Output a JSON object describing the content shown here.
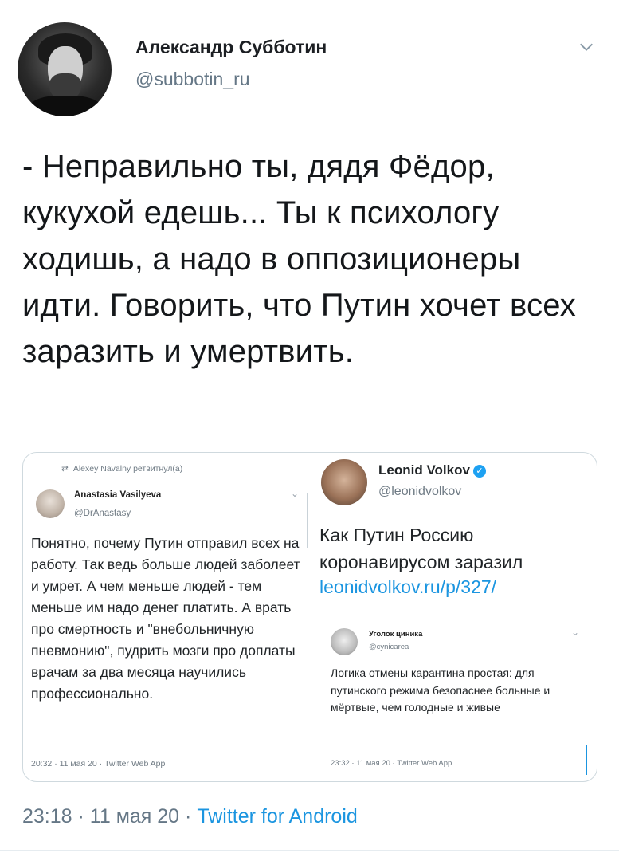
{
  "tweet": {
    "author_name": "Александр Субботин",
    "author_handle": "@subbotin_ru",
    "text": "- Неправильно ты, дядя Фёдор, кукухой едешь... Ты к психологу ходишь, а надо в оппозиционеры идти. Говорить, что Путин хочет всех заразить и умертвить.",
    "time": "23:18",
    "date": "11 мая 20",
    "client": "Twitter for Android",
    "separator": "·"
  },
  "embedded": {
    "left": {
      "retweeted_by": "Alexey Navalny ретвитнул(а)",
      "author_name": "Anastasia Vasilyeva",
      "author_handle": "@DrAnastasy",
      "text": "Понятно, почему Путин отправил всех на работу. Так ведь больше людей заболеет и умрет. А чем меньше людей - тем меньше им надо денег платить. А врать про смертность и \"внебольничную пневмонию\", пудрить мозги про доплаты врачам за два месяца научились профессионально.",
      "meta": "20:32 · 11 мая 20 · Twitter Web App"
    },
    "right": {
      "author_name": "Leonid Volkov",
      "author_handle": "@leonidvolkov",
      "text": "Как Путин Россию коронавирусом заразил",
      "link": "leonidvolkov.ru/p/327/",
      "quoted": {
        "author_name": "Уголок циника",
        "author_handle": "@cynicarea",
        "text": "Логика отмены карантина простая: для путинского режима безопаснее больные и мёртвые, чем голодные и живые",
        "meta": "23:32 · 11 мая 20 · Twitter Web App"
      }
    }
  },
  "colors": {
    "link": "#1b95e0",
    "muted": "#657786",
    "text": "#14171a",
    "border": "#cfd9de"
  },
  "icons": [
    "chevron-down-icon",
    "retweet-icon",
    "verified-badge-icon"
  ]
}
